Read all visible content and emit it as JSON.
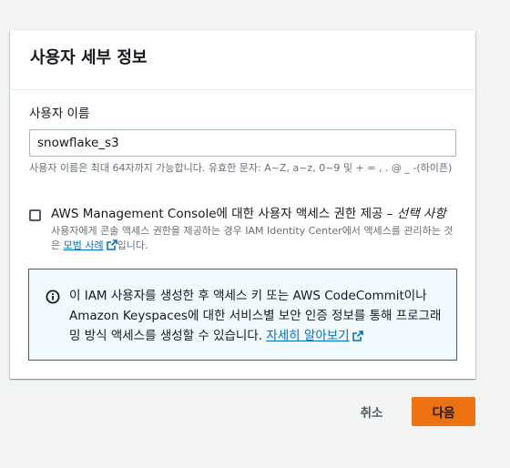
{
  "panel": {
    "title": "사용자 세부 정보"
  },
  "username": {
    "label": "사용자 이름",
    "value": "snowflake_s3",
    "hint": "사용자 이름은 최대 64자까지 가능합니다. 유효한 문자: A~Z, a~z, 0~9 및 + = , . @ _ -(하이픈)"
  },
  "console_access": {
    "label": "AWS Management Console에 대한 사용자 액세스 권한 제공 – ",
    "optional": "선택 사항",
    "checked": false,
    "desc_prefix": "사용자에게 콘솔 액세스 권한을 제공하는 경우 IAM Identity Center에서 액세스를 관리하는 것은 ",
    "desc_link": "모범 사례",
    "desc_suffix": "입니다."
  },
  "info": {
    "text": "이 IAM 사용자를 생성한 후 액세스 키 또는 AWS CodeCommit이나 Amazon Keyspaces에 대한 서비스별 보안 인증 정보를 통해 프로그래밍 방식 액세스를 생성할 수 있습니다. ",
    "link": "자세히 알아보기"
  },
  "footer": {
    "cancel": "취소",
    "next": "다음"
  },
  "colors": {
    "primary": "#ec7211",
    "link": "#0073bb",
    "info_bg": "#f1faff"
  },
  "icons": [
    "info-icon",
    "external-link-icon"
  ]
}
